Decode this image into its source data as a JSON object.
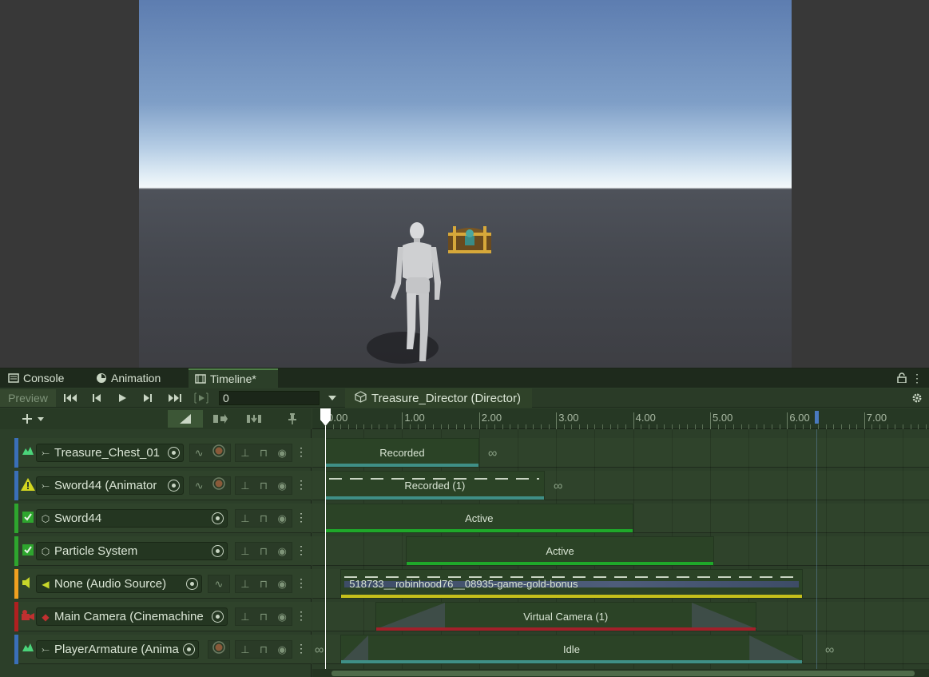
{
  "tabs": [
    {
      "label": "Console",
      "icon": "console-icon"
    },
    {
      "label": "Animation",
      "icon": "animation-clock-icon"
    },
    {
      "label": "Timeline*",
      "icon": "timeline-film-icon"
    }
  ],
  "toolbar": {
    "preview_label": "Preview",
    "frame_value": "0",
    "director_label": "Treasure_Director (Director)"
  },
  "ruler": {
    "ticks": [
      "0.00",
      "1.00",
      "2.00",
      "3.00",
      "4.00",
      "5.00",
      "6.00",
      "7.00"
    ]
  },
  "tracks": [
    {
      "label": "Treasure_Chest_01",
      "color": "#3a6fb8",
      "icon": "animation-track-icon"
    },
    {
      "label": "Sword44 (Animator",
      "color": "#3a6fb8",
      "icon": "warning-icon"
    },
    {
      "label": "Sword44",
      "color": "#2ea52e",
      "icon": "activation-track-icon"
    },
    {
      "label": "Particle System",
      "color": "#2ea52e",
      "icon": "activation-track-icon"
    },
    {
      "label": "None (Audio Source)",
      "color": "#f0a020",
      "icon": "audio-track-icon"
    },
    {
      "label": "Main Camera (Cinemachine",
      "color": "#b02020",
      "icon": "cinemachine-track-icon"
    },
    {
      "label": "PlayerArmature (Anima",
      "color": "#3a6fb8",
      "icon": "animation-track-icon"
    }
  ],
  "clips": [
    {
      "label": "Recorded",
      "track": 0,
      "start": 0.0,
      "end": 2.0,
      "bar_color": "#3f8f86"
    },
    {
      "label": "Recorded (1)",
      "track": 1,
      "start": 0.0,
      "end": 2.85,
      "bar_color": "#3f8f86"
    },
    {
      "label": "Active",
      "track": 2,
      "start": 0.0,
      "end": 4.0,
      "bar_color": "#1fa82a"
    },
    {
      "label": "Active",
      "track": 3,
      "start": 1.05,
      "end": 5.05,
      "bar_color": "#1fa82a"
    },
    {
      "label": "518733__robinhood76__08935-game-gold-bonus",
      "track": 4,
      "start": 0.2,
      "end": 6.2,
      "bar_color": "#c4bf1b"
    },
    {
      "label": "Virtual Camera (1)",
      "track": 5,
      "start": 0.65,
      "end": 5.6,
      "bar_color": "#a2202a"
    },
    {
      "label": "Idle",
      "track": 6,
      "start": 0.2,
      "end": 6.2,
      "bar_color": "#3f8f86"
    }
  ]
}
